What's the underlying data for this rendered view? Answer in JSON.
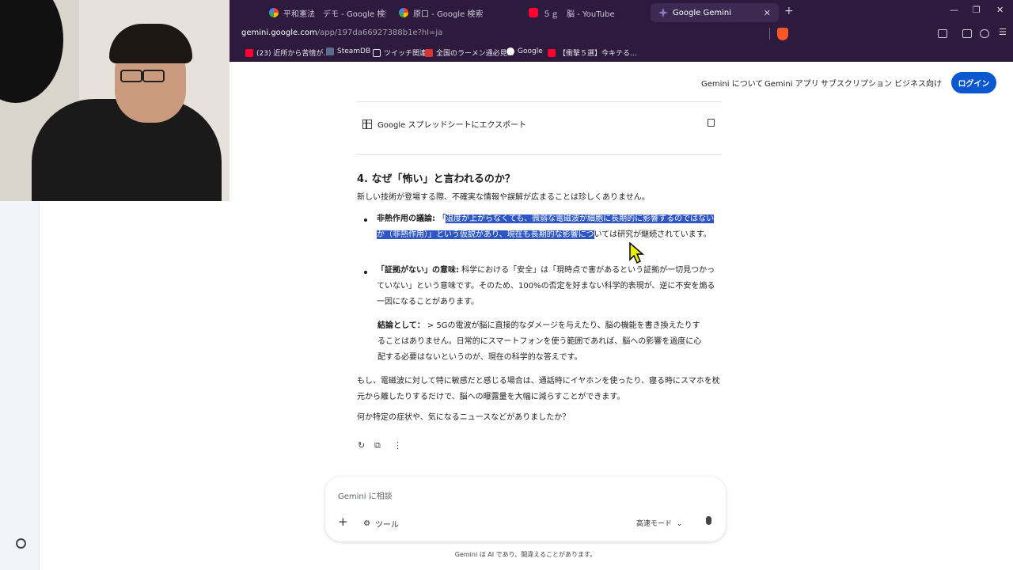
{
  "tabs": [
    {
      "title": "平和憲法　デモ - Google 検索",
      "favicon": "google-icon"
    },
    {
      "title": "原口 - Google 検索",
      "favicon": "google-icon"
    },
    {
      "title": "５ｇ　脳 - YouTube",
      "favicon": "youtube-icon"
    },
    {
      "title": "Google Gemini",
      "favicon": "gemini-icon",
      "active": true
    }
  ],
  "address": {
    "host": "gemini.google.com",
    "path": "/app/197da66927388b1e?hl=ja"
  },
  "bookmarks": [
    {
      "label": "(23) 近所から苦情が..."
    },
    {
      "label": "SteamDB"
    },
    {
      "label": "ツイッチ関連"
    },
    {
      "label": "全国のラーメン通必見..."
    },
    {
      "label": "Google"
    },
    {
      "label": "【衝撃５選】今キテる..."
    }
  ],
  "nav": {
    "about": "Gemini について",
    "apps": "Gemini アプリ",
    "subscriptions": "サブスクリプション",
    "business": "ビジネス向け",
    "login": "ログイン"
  },
  "response": {
    "export_label": "Google スプレッドシートにエクスポート",
    "heading": "4. なぜ「怖い」と言われるのか？",
    "intro": "新しい技術が登場する際、不確実な情報や誤解が広まることは珍しくありません。",
    "bullet1_title": "非熱作用の議論:",
    "bullet1_open": "「",
    "bullet1_selected_a": "温度が上がらなくても、微弱な電磁波が細胞に長期的に影響するのではないか（非熱作用）」という仮説があり、現在も長期的な影響につ",
    "bullet1_rest": "いては研究が継続されています。",
    "bullet2_title": "「証拠がない」の意味:",
    "bullet2_body": " 科学における「安全」は「現時点で害があるという証拠が一切見つかっていない」という意味です。そのため、100%の否定を好まない科学的表現が、逆に不安を煽る一因になることがあります。",
    "conclusion_title": "結論として：",
    "conclusion_body": " > 5Gの電波が脳に直接的なダメージを与えたり、脳の機能を書き換えたりすることはありません。日常的にスマートフォンを使う範囲であれば、脳への影響を過度に心配する必要はないというのが、現在の科学的な答えです。",
    "advice": "もし、電磁波に対して特に敏感だと感じる場合は、通話時にイヤホンを使ったり、寝る時にスマホを枕元から離したりするだけで、脳への曝露量を大幅に減らすことができます。",
    "question": "何か特定の症状や、気になるニュースなどがありましたか？"
  },
  "composer": {
    "placeholder": "Gemini に相談",
    "tools_label": "ツール",
    "mode_label": "高速モード"
  },
  "disclaimer": "Gemini は AI であり、間違えることがあります。",
  "colors": {
    "accent": "#0b57d0",
    "selection": "#2f56c6",
    "chrome": "#2c1b3d"
  }
}
